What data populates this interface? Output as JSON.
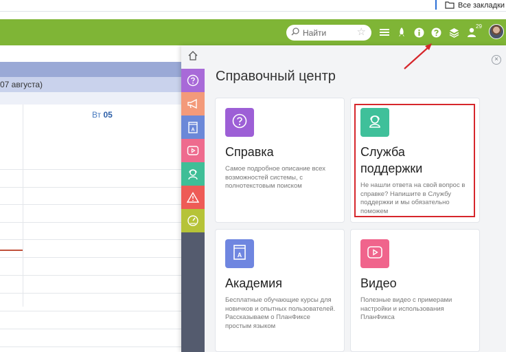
{
  "browser": {
    "bookmark_label": "Все закладки"
  },
  "topbar": {
    "search_placeholder": "Найти",
    "notifications_badge": "29",
    "accent_color": "#7fb536"
  },
  "background": {
    "date_range_tail": "07 августа)",
    "day_prefix": "Вт ",
    "day_number": "05"
  },
  "panel": {
    "title": "Справочный центр",
    "close_symbol": "×",
    "rail": [
      {
        "icon": "home-icon",
        "color": "#f3f4f6"
      },
      {
        "icon": "help-icon",
        "color": "#a86ad8"
      },
      {
        "icon": "megaphone-icon",
        "color": "#f39a7a"
      },
      {
        "icon": "academy-book-icon",
        "color": "#6b88d8"
      },
      {
        "icon": "video-icon",
        "color": "#ee6b8e"
      },
      {
        "icon": "support-agent-icon",
        "color": "#3fbe97"
      },
      {
        "icon": "warning-icon",
        "color": "#ee5b56"
      },
      {
        "icon": "gauge-icon",
        "color": "#b6c338"
      }
    ],
    "cards": [
      {
        "title": "Справка",
        "description": "Самое подробное описание всех возможностей системы, с полнотекстовым поиском",
        "icon": "help-icon",
        "color": "#9d5fd6"
      },
      {
        "title": "Служба поддержки",
        "description": "Не нашли ответа на свой вопрос в справке? Напишите в Службу поддержки и мы обязательно поможем",
        "icon": "support-agent-icon",
        "color": "#3fc09a"
      },
      {
        "title": "Академия",
        "description": "Бесплатные обучающие курсы для новичков и опытных пользователей. Рассказываем о ПланФиксе простым языком",
        "icon": "academy-book-icon",
        "color": "#6f86e0"
      },
      {
        "title": "Видео",
        "description": "Полезные видео с примерами настройки и использования ПланФикса",
        "icon": "video-icon",
        "color": "#f0648c"
      }
    ]
  }
}
